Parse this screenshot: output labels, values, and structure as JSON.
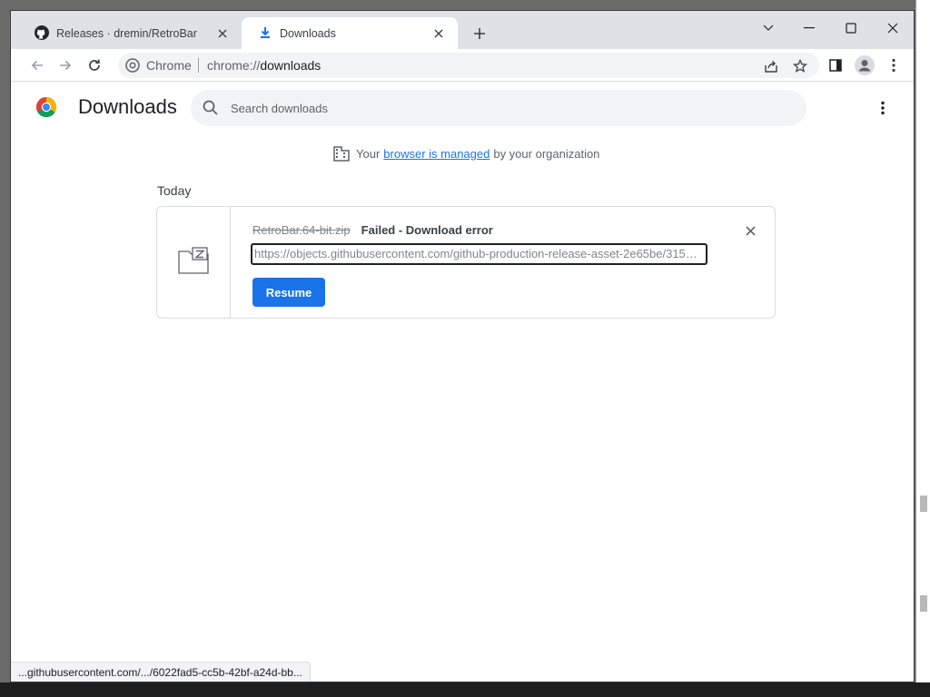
{
  "window": {
    "tabs": [
      {
        "title": "Releases · dremin/RetroBar",
        "favicon": "github-icon",
        "active": false
      },
      {
        "title": "Downloads",
        "favicon": "download-icon",
        "active": true
      }
    ],
    "controls": [
      "tab-search-icon",
      "minimize-icon",
      "maximize-icon",
      "close-icon"
    ]
  },
  "toolbar": {
    "omnibox": {
      "chip_label": "Chrome",
      "url_scheme": "chrome://",
      "url_host": "downloads"
    },
    "icons": [
      "back-icon",
      "forward-icon",
      "reload-icon",
      "share-icon",
      "bookmark-star-icon",
      "side-panel-icon",
      "profile-icon",
      "menu-icon"
    ]
  },
  "page": {
    "title": "Downloads",
    "search": {
      "placeholder": "Search downloads",
      "value": ""
    },
    "managed_notice": {
      "prefix": "Your",
      "link": "browser is managed",
      "suffix": "by your organization"
    },
    "date_header": "Today",
    "downloads": [
      {
        "filename": "RetroBar.64-bit.zip",
        "status": "Failed - Download error",
        "url": "https://objects.githubusercontent.com/github-production-release-asset-2e65be/315…",
        "action_label": "Resume",
        "file_icon": "zip-file-icon"
      }
    ]
  },
  "status_bar": {
    "text": "...githubusercontent.com/.../6022fad5-cc5b-42bf-a24d-bb..."
  },
  "colors": {
    "accent": "#1a73e8",
    "tabstrip": "#dee1e6",
    "omnibox": "#f1f3f4"
  }
}
